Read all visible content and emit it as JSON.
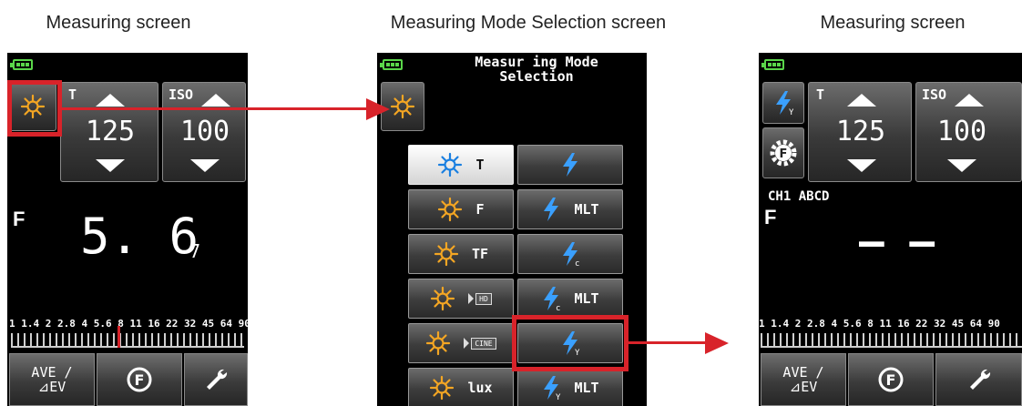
{
  "captions": {
    "left": "Measuring screen",
    "middle": "Measuring Mode Selection screen",
    "right": "Measuring screen"
  },
  "colors": {
    "highlight": "#d8232a",
    "battery": "#5ad64a",
    "sun_icon": "#f4a623",
    "active_sun_icon": "#1a7fe0",
    "bolt_icon": "#3aa0ff"
  },
  "screen1": {
    "t_label": "T",
    "shutter_value": "125",
    "iso_label": "ISO",
    "iso_value": "100",
    "f_label": "F",
    "f_value": "5. 6",
    "f_subvalue": "7",
    "scale": "1 1.4 2 2.8 4 5.6 8 11 16 22 32 45 64 90",
    "ave_top": "AVE /",
    "ave_bottom": "⊿EV"
  },
  "screen2": {
    "title_line1": "Measur ing Mode",
    "title_line2": "Selection",
    "modes": [
      {
        "left_label": "T",
        "right_label": ""
      },
      {
        "left_label": "F",
        "right_label": "MLT"
      },
      {
        "left_label": "TF",
        "right_label": ""
      },
      {
        "left_label": "HD",
        "right_label": "MLT"
      },
      {
        "left_label": "CINE",
        "right_label": ""
      },
      {
        "left_label": "lux",
        "right_label": "MLT"
      }
    ],
    "subscripts": [
      "",
      "",
      "c",
      "c",
      "Y",
      "Y"
    ]
  },
  "screen3": {
    "t_label": "T",
    "shutter_value": "125",
    "iso_label": "ISO",
    "iso_value": "100",
    "channel_info": "CH1 ABCD",
    "f_label": "F",
    "f_value": "– –",
    "scale": "1 1.4 2 2.8 4 5.6 8 11 16 22 32 45 64 90",
    "ave_top": "AVE /",
    "ave_bottom": "⊿EV"
  }
}
